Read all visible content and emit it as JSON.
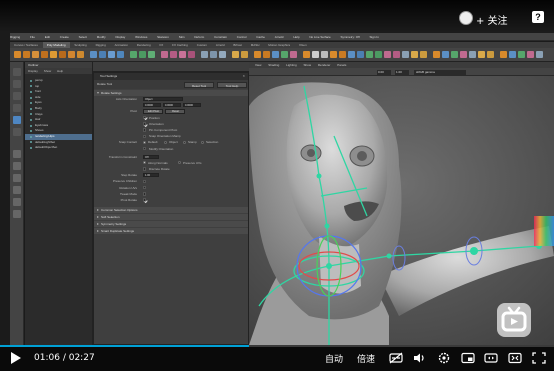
{
  "overlay": {
    "follow_label": "+ 关注",
    "help_label": "?"
  },
  "maya": {
    "menubar": [
      "Rigging",
      "File",
      "Edit",
      "Create",
      "Select",
      "Modify",
      "Display",
      "Windows",
      "Skeleton",
      "Skin",
      "Deform",
      "Constrain",
      "Control",
      "Cache",
      "Arnold",
      "Help"
    ],
    "shelf_tabs": [
      "Curves / Surfaces",
      "Poly Modeling",
      "Sculpting",
      "Rigging",
      "Animation",
      "Rendering",
      "FX",
      "FX Caching",
      "Custom",
      "Arnold",
      "Bifrost",
      "MASH",
      "Motion Graphics",
      "XGen"
    ],
    "active_shelf_tab": 1,
    "shelf_extra": {
      "no_live_surface": "No Live Surface",
      "symmetry": "Symmetry: Off",
      "sign_in": "Sign In"
    },
    "outliner": {
      "title": "Outliner",
      "menu": [
        "Display",
        "Show",
        "Help"
      ],
      "items": [
        "persp",
        "top",
        "front",
        "side",
        "Eyes",
        "Body",
        "Clays",
        "Hair",
        "Eyebrows",
        "Shoes",
        "rendering:Hips",
        "defaultLightSet",
        "defaultObjectSet"
      ],
      "selected_index": 10
    },
    "tool_settings": {
      "window_title": "Tool Settings",
      "tool_name": "Rotate Tool",
      "reset_label": "Reset Tool",
      "help_label": "Tool Help",
      "sections": {
        "rotate_settings": "Rotate Settings",
        "common_selection": "Common Selection Options",
        "soft_selection": "Soft Selection",
        "symmetry": "Symmetry Settings",
        "smart_duplicate": "Smart Duplicate Settings"
      },
      "axis_orientation_label": "Axis Orientation",
      "axis_orientation_value": "Object",
      "axis_values": [
        "0.0000",
        "0.0000",
        "0.0000"
      ],
      "pivot_label": "Pivot",
      "edit_pivot": "Edit Pivot",
      "reset_pivot": "Reset",
      "checkboxes": [
        {
          "label": "Position",
          "on": true
        },
        {
          "label": "Orientation",
          "on": true
        },
        {
          "label": "Pin Component Pivot",
          "on": false
        },
        {
          "label": "Snap Orientation Manip",
          "on": false
        }
      ],
      "snap_label": "Snap Contact",
      "snap_options": [
        "Default",
        "Object",
        "Stamp",
        "Selection"
      ],
      "snap_selected": 0,
      "modify_orientation": "Modify Orientation",
      "transform_constraint_label": "Transform Constraint",
      "transform_constraint_value": "Off",
      "along_normals": "Along Normals",
      "preserve_uv": "Preserve UVs",
      "discrete_rotate": "Discrete Rotate",
      "step_label": "Step Rotate",
      "step_value": "1.00",
      "extra_rows": [
        "Preserve Children",
        "Rotation UVs",
        "Tweak Mode",
        "Pivot Rotate"
      ]
    },
    "viewport": {
      "menu": [
        "View",
        "Shading",
        "Lighting",
        "Show",
        "Renderer",
        "Panels"
      ],
      "camera_label": "sRGB gamma",
      "field_a": "0.00",
      "field_b": "1.00"
    }
  },
  "player": {
    "current_time": "01:06",
    "separator": "/",
    "duration": "02:27",
    "progress_fraction": 0.449,
    "auto_label": "自动",
    "speed_label": "倍速",
    "accent": "#00a1d6"
  }
}
